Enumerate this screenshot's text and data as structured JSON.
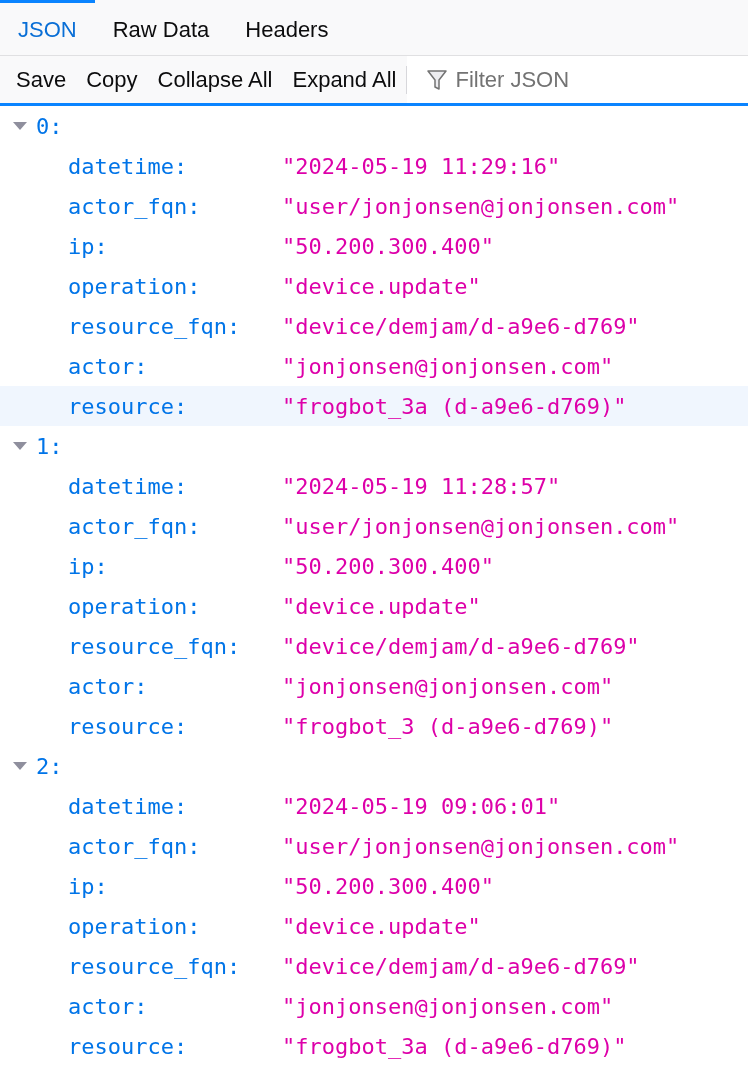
{
  "tabs": [
    {
      "label": "JSON",
      "selected": true
    },
    {
      "label": "Raw Data",
      "selected": false
    },
    {
      "label": "Headers",
      "selected": false
    }
  ],
  "toolbar": {
    "buttons": [
      "Save",
      "Copy",
      "Collapse All",
      "Expand All"
    ],
    "filter": {
      "placeholder": "Filter JSON"
    }
  },
  "records": [
    {
      "key": "0:",
      "expanded": true,
      "fields": [
        {
          "key": "datetime:",
          "value": "\"2024-05-19 11:29:16\"",
          "hovered": false
        },
        {
          "key": "actor_fqn:",
          "value": "\"user/jonjonsen@jonjonsen.com\"",
          "hovered": false
        },
        {
          "key": "ip:",
          "value": "\"50.200.300.400\"",
          "hovered": false
        },
        {
          "key": "operation:",
          "value": "\"device.update\"",
          "hovered": false
        },
        {
          "key": "resource_fqn:",
          "value": "\"device/demjam/d-a9e6-d769\"",
          "hovered": false
        },
        {
          "key": "actor:",
          "value": "\"jonjonsen@jonjonsen.com\"",
          "hovered": false
        },
        {
          "key": "resource:",
          "value": "\"frogbot_3a (d-a9e6-d769)\"",
          "hovered": true
        }
      ]
    },
    {
      "key": "1:",
      "expanded": true,
      "fields": [
        {
          "key": "datetime:",
          "value": "\"2024-05-19 11:28:57\"",
          "hovered": false
        },
        {
          "key": "actor_fqn:",
          "value": "\"user/jonjonsen@jonjonsen.com\"",
          "hovered": false
        },
        {
          "key": "ip:",
          "value": "\"50.200.300.400\"",
          "hovered": false
        },
        {
          "key": "operation:",
          "value": "\"device.update\"",
          "hovered": false
        },
        {
          "key": "resource_fqn:",
          "value": "\"device/demjam/d-a9e6-d769\"",
          "hovered": false
        },
        {
          "key": "actor:",
          "value": "\"jonjonsen@jonjonsen.com\"",
          "hovered": false
        },
        {
          "key": "resource:",
          "value": "\"frogbot_3 (d-a9e6-d769)\"",
          "hovered": false
        }
      ]
    },
    {
      "key": "2:",
      "expanded": true,
      "fields": [
        {
          "key": "datetime:",
          "value": "\"2024-05-19 09:06:01\"",
          "hovered": false
        },
        {
          "key": "actor_fqn:",
          "value": "\"user/jonjonsen@jonjonsen.com\"",
          "hovered": false
        },
        {
          "key": "ip:",
          "value": "\"50.200.300.400\"",
          "hovered": false
        },
        {
          "key": "operation:",
          "value": "\"device.update\"",
          "hovered": false
        },
        {
          "key": "resource_fqn:",
          "value": "\"device/demjam/d-a9e6-d769\"",
          "hovered": false
        },
        {
          "key": "actor:",
          "value": "\"jonjonsen@jonjonsen.com\"",
          "hovered": false
        },
        {
          "key": "resource:",
          "value": "\"frogbot_3a (d-a9e6-d769)\"",
          "hovered": false
        }
      ]
    }
  ]
}
